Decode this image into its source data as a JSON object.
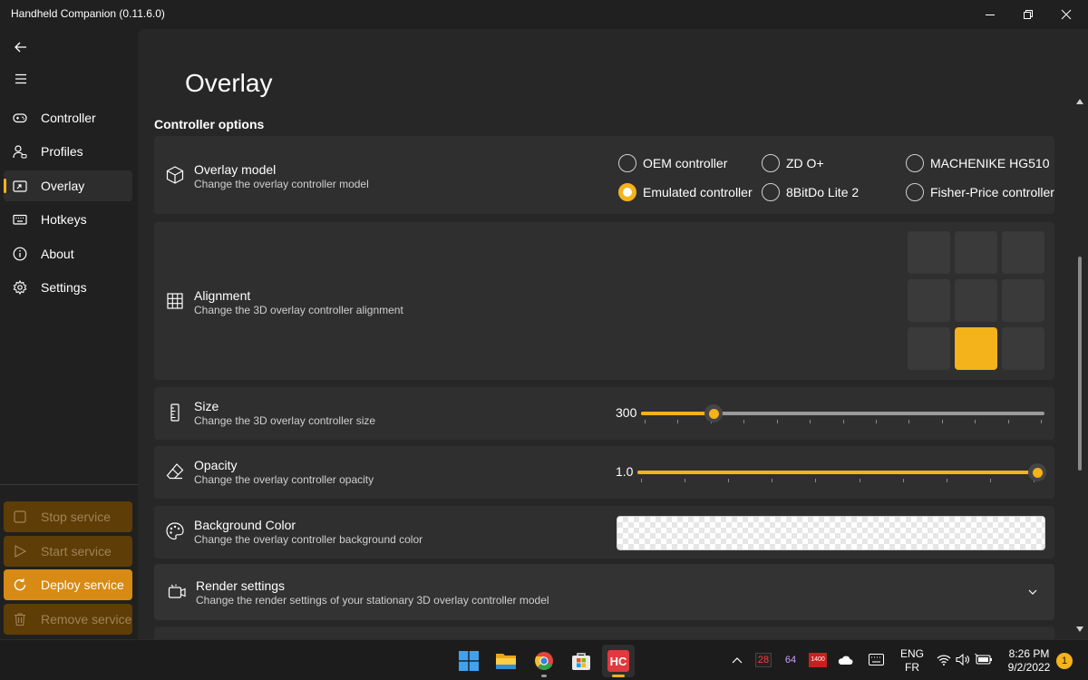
{
  "app": {
    "title": "Handheld Companion (0.11.6.0)"
  },
  "window_controls": {
    "minimize_icon": "minimize-icon",
    "maximize_icon": "restore-icon",
    "close_icon": "close-icon"
  },
  "sidebar": {
    "back_icon": "back-arrow-icon",
    "menu_icon": "hamburger-menu-icon",
    "items": [
      {
        "label": "Controller",
        "icon": "gamepad-icon",
        "active": false
      },
      {
        "label": "Profiles",
        "icon": "profiles-icon",
        "active": false
      },
      {
        "label": "Overlay",
        "icon": "overlay-icon",
        "active": true
      },
      {
        "label": "Hotkeys",
        "icon": "keyboard-icon",
        "active": false
      },
      {
        "label": "About",
        "icon": "info-icon",
        "active": false
      },
      {
        "label": "Settings",
        "icon": "gear-icon",
        "active": false
      }
    ],
    "service_buttons": [
      {
        "label": "Stop service",
        "icon": "stop-icon",
        "enabled": false
      },
      {
        "label": "Start service",
        "icon": "play-icon",
        "enabled": false
      },
      {
        "label": "Deploy service",
        "icon": "refresh-icon",
        "enabled": true
      },
      {
        "label": "Remove service",
        "icon": "trash-icon",
        "enabled": false
      }
    ]
  },
  "page": {
    "title": "Overlay",
    "section_title": "Controller options",
    "overlay_model": {
      "title": "Overlay model",
      "desc": "Change the overlay controller model",
      "options": [
        {
          "label": "OEM controller",
          "selected": false
        },
        {
          "label": "ZD O+",
          "selected": false
        },
        {
          "label": "MACHENIKE HG510",
          "selected": false
        },
        {
          "label": "Emulated controller",
          "selected": true
        },
        {
          "label": "8BitDo Lite 2",
          "selected": false
        },
        {
          "label": "Fisher-Price controller",
          "selected": false
        }
      ]
    },
    "alignment": {
      "title": "Alignment",
      "desc": "Change the 3D overlay controller alignment",
      "grid_rows": 3,
      "grid_cols": 3,
      "selected_row": 2,
      "selected_col": 1
    },
    "size": {
      "title": "Size",
      "desc": "Change the 3D overlay controller size",
      "value": "300",
      "fraction": 0.18,
      "ticks": 13
    },
    "opacity": {
      "title": "Opacity",
      "desc": "Change the overlay controller opacity",
      "value": "1.0",
      "fraction": 1.0,
      "ticks": 10
    },
    "background_color": {
      "title": "Background Color",
      "desc": "Change the overlay controller background color",
      "value": "transparent"
    },
    "render_settings": {
      "title": "Render settings",
      "desc": "Change the render settings of your stationary 3D overlay controller model",
      "icon": "render-icon",
      "expand_icon": "chevron-down-icon"
    }
  },
  "colors": {
    "accent": "#f4b21b",
    "deploy": "#d78a14",
    "card": "#2f2f2f",
    "background": "#202020"
  },
  "taskbar": {
    "apps": [
      "windows-start-icon",
      "file-explorer-icon",
      "chrome-icon",
      "microsoft-store-icon",
      "handheld-companion-icon"
    ],
    "hc_label": "HC",
    "tray": {
      "chevron_icon": "chevron-up-icon",
      "indicators": [
        "28",
        "64",
        "1400"
      ],
      "cloud_icon": "onedrive-icon",
      "keyboard_icon": "touch-keyboard-icon",
      "lang": "ENG",
      "layout": "FR",
      "wifi_icon": "wifi-icon",
      "volume_icon": "volume-icon",
      "battery_icon": "battery-icon",
      "time": "8:26 PM",
      "date": "9/2/2022",
      "notification_count": "1"
    }
  }
}
